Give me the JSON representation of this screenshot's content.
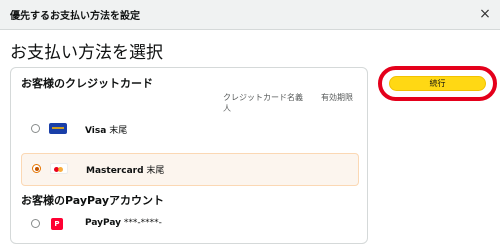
{
  "header": {
    "title": "優先するお支払い方法を設定",
    "close_label": "×"
  },
  "page_title": "お支払い方法を選択",
  "cards_section": {
    "title": "お客様のクレジットカード",
    "col_name": "クレジットカード名義人",
    "col_expiry": "有効期限",
    "items": [
      {
        "brand": "Visa",
        "suffix": " 末尾",
        "icon": "visa-card-icon",
        "selected": false
      },
      {
        "brand": "Mastercard",
        "suffix": " 末尾",
        "icon": "mastercard-card-icon",
        "selected": true
      }
    ]
  },
  "paypay_section": {
    "title": "お客様のPayPayアカウント",
    "items": [
      {
        "brand": "PayPay",
        "suffix": " ***-****-",
        "icon": "paypay-icon",
        "icon_text": "P",
        "selected": false
      }
    ]
  },
  "continue_label": "続行",
  "colors": {
    "accent_button": "#ffd814",
    "highlight_ring": "#e4001b",
    "selected_row_bg": "#fcf5ee"
  }
}
